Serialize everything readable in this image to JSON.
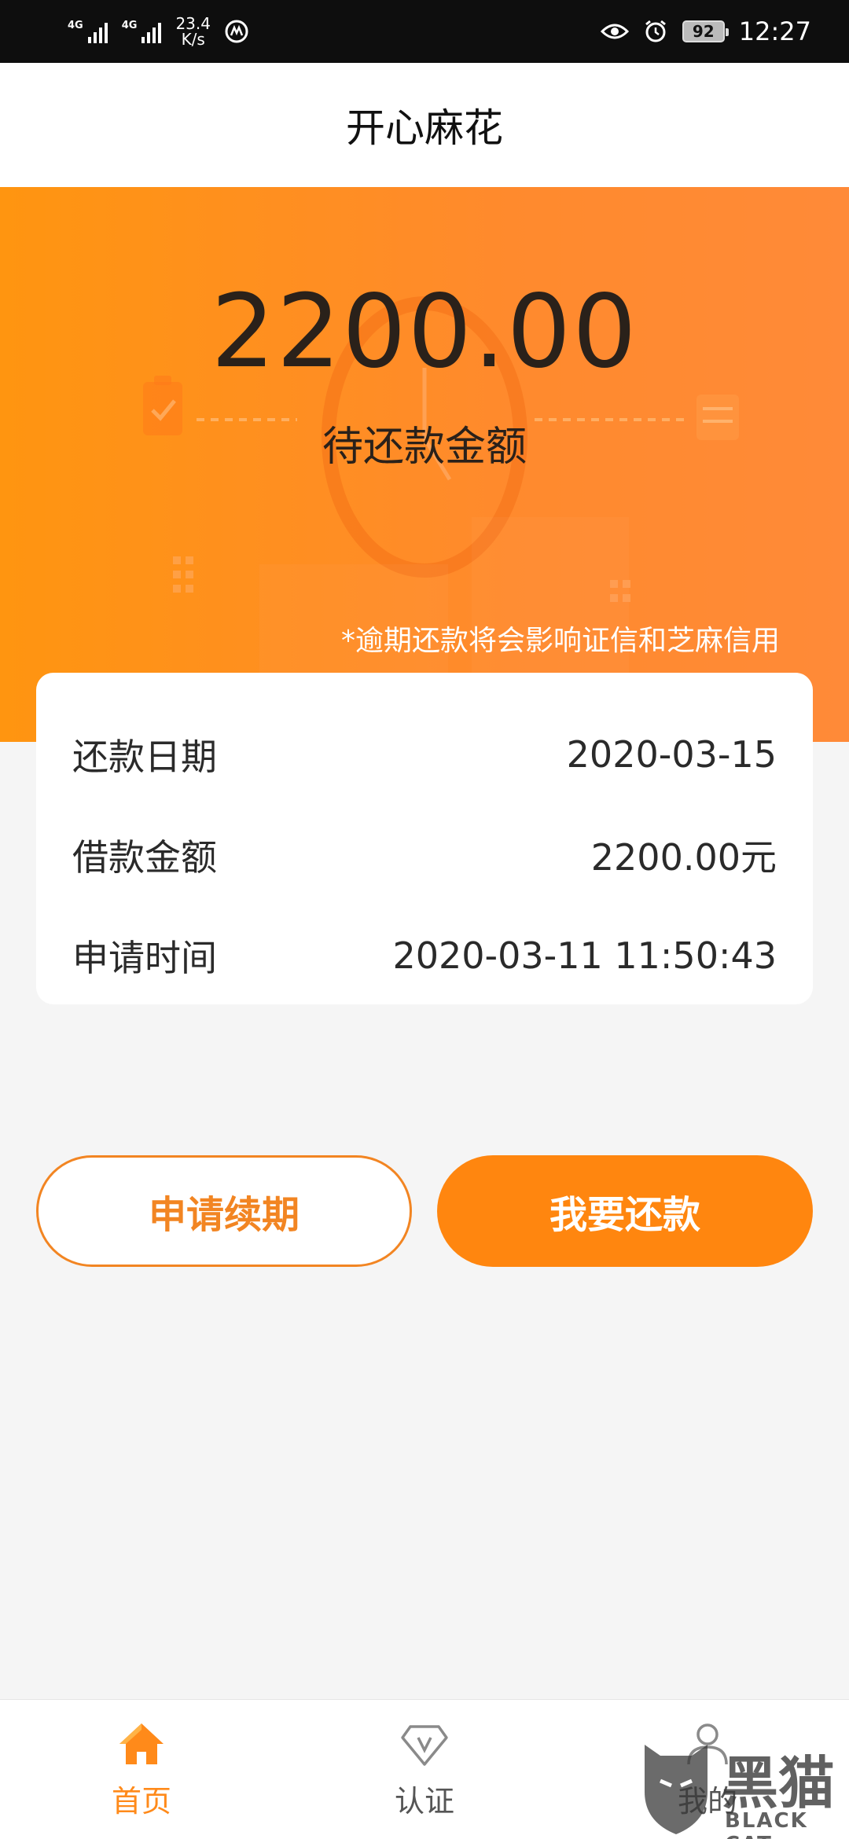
{
  "status_bar": {
    "network_1": "4G",
    "network_2": "4G",
    "speed_value": "23.4",
    "speed_unit": "K/s",
    "battery": "92",
    "time": "12:27",
    "icons": [
      "signal-icon",
      "data-speed-icon",
      "app-notification-icon",
      "eye-icon",
      "alarm-icon",
      "battery-icon"
    ]
  },
  "header": {
    "title": "开心麻花"
  },
  "hero": {
    "amount": "2200.00",
    "amount_label": "待还款金额",
    "warning": "*逾期还款将会影响证信和芝麻信用"
  },
  "details": {
    "rows": [
      {
        "label": "还款日期",
        "value": "2020-03-15"
      },
      {
        "label": "借款金额",
        "value": "2200.00元"
      },
      {
        "label": "申请时间",
        "value": "2020-03-11 11:50:43"
      }
    ]
  },
  "actions": {
    "renew_label": "申请续期",
    "repay_label": "我要还款"
  },
  "bottom_nav": {
    "items": [
      {
        "label": "首页",
        "icon": "home-icon",
        "active": true
      },
      {
        "label": "认证",
        "icon": "verify-icon",
        "active": false
      },
      {
        "label": "我的",
        "icon": "user-icon",
        "active": false
      }
    ]
  },
  "watermark": {
    "text": "黑猫",
    "sub": "BLACK CAT"
  },
  "colors": {
    "accent": "#ff860f",
    "accent_text": "#f28522",
    "nav_active": "#ff8a1a"
  }
}
